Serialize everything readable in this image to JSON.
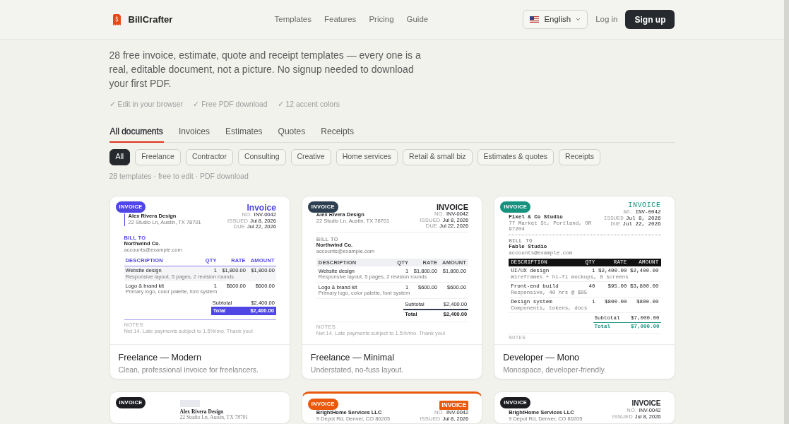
{
  "nav": {
    "brand": "BillCrafter",
    "links": [
      "Templates",
      "Features",
      "Pricing",
      "Guide"
    ],
    "language": "English",
    "login": "Log in",
    "signup": "Sign up"
  },
  "intro": {
    "text": "28 free invoice, estimate, quote and receipt templates — every one is a real, editable document, not a picture. No signup needed to download your first PDF.",
    "features": [
      "✓ Edit in your browser",
      "✓ Free PDF download",
      "✓ 12 accent colors"
    ]
  },
  "tabs": [
    {
      "label": "All documents",
      "selected": true
    },
    {
      "label": "Invoices",
      "selected": false
    },
    {
      "label": "Estimates",
      "selected": false
    },
    {
      "label": "Quotes",
      "selected": false
    },
    {
      "label": "Receipts",
      "selected": false
    }
  ],
  "filters": [
    {
      "label": "All",
      "selected": true
    },
    {
      "label": "Freelance",
      "selected": false
    },
    {
      "label": "Contractor",
      "selected": false
    },
    {
      "label": "Consulting",
      "selected": false
    },
    {
      "label": "Creative",
      "selected": false
    },
    {
      "label": "Home services",
      "selected": false
    },
    {
      "label": "Retail & small biz",
      "selected": false
    },
    {
      "label": "Estimates & quotes",
      "selected": false
    },
    {
      "label": "Receipts",
      "selected": false
    }
  ],
  "summary": "28 templates · free to edit · PDF download",
  "templates": [
    {
      "title": "Freelance — Modern",
      "description": "Clean, professional invoice for freelancers.",
      "preview": {
        "kind": "modern",
        "color": "#4f46e5",
        "badge": "INVOICE",
        "heading": "Invoice",
        "from": {
          "name": "Alex Rivera Design",
          "address": "22 Studio Ln, Austin, TX 78701"
        },
        "meta": [
          {
            "label": "NO.",
            "value": "INV-0042"
          },
          {
            "label": "ISSUED",
            "value": "Jul 8, 2026"
          },
          {
            "label": "DUE",
            "value": "Jul 22, 2026"
          }
        ],
        "bill_to": {
          "label": "BILL TO",
          "name": "Northwind Co.",
          "email": "accounts@example.com"
        },
        "columns": [
          "DESCRIPTION",
          "QTY",
          "RATE",
          "AMOUNT"
        ],
        "items": [
          {
            "name": "Website design",
            "detail": "Responsive layout, 5 pages, 2 revision rounds",
            "qty": "1",
            "rate": "$1,800.00",
            "amount": "$1,800.00"
          },
          {
            "name": "Logo & brand kit",
            "detail": "Primary logo, color palette, font system",
            "qty": "1",
            "rate": "$600.00",
            "amount": "$600.00"
          }
        ],
        "subtotal": {
          "label": "Subtotal",
          "value": "$2,400.00"
        },
        "total": {
          "label": "Total",
          "value": "$2,400.00"
        },
        "notes": {
          "label": "NOTES",
          "text": "Net 14. Late payments subject to 1.5%/mo. Thank you!"
        }
      }
    },
    {
      "title": "Freelance — Minimal",
      "description": "Understated, no-fuss layout.",
      "preview": {
        "kind": "minimal",
        "color": "#2c3e50",
        "badge": "INVOICE",
        "heading": "INVOICE",
        "from": {
          "name": "Alex Rivera Design",
          "address": "22 Studio Ln, Austin, TX 78701"
        },
        "meta": [
          {
            "label": "NO.",
            "value": "INV-0042"
          },
          {
            "label": "ISSUED",
            "value": "Jul 8, 2026"
          },
          {
            "label": "DUE",
            "value": "Jul 22, 2026"
          }
        ],
        "bill_to": {
          "label": "BILL TO",
          "name": "Northwind Co.",
          "email": "accounts@example.com"
        },
        "columns": [
          "DESCRIPTION",
          "QTY",
          "RATE",
          "AMOUNT"
        ],
        "items": [
          {
            "name": "Website design",
            "detail": "Responsive layout, 5 pages, 2 revision rounds",
            "qty": "1",
            "rate": "$1,800.00",
            "amount": "$1,800.00"
          },
          {
            "name": "Logo & brand kit",
            "detail": "Primary logo, color palette, font system",
            "qty": "1",
            "rate": "$600.00",
            "amount": "$600.00"
          }
        ],
        "subtotal": {
          "label": "Subtotal",
          "value": "$2,400.00"
        },
        "total": {
          "label": "Total",
          "value": "$2,400.00"
        },
        "notes": {
          "label": "NOTES",
          "text": "Net 14. Late payments subject to 1.5%/mo. Thank you!"
        }
      }
    },
    {
      "title": "Developer — Mono",
      "description": "Monospace, developer-friendly.",
      "preview": {
        "kind": "mono",
        "color": "#16927f",
        "badge": "INVOICE",
        "heading": "INVOICE",
        "from": {
          "name": "Pixel & Co Studio",
          "address": "77 Market St, Portland, OR 97204"
        },
        "meta": [
          {
            "label": "NO.",
            "value": "INV-0042"
          },
          {
            "label": "ISSUED",
            "value": "Jul 8, 2026"
          },
          {
            "label": "DUE",
            "value": "Jul 22, 2026"
          }
        ],
        "bill_to": {
          "label": "BILL TO",
          "name": "Fable Studio",
          "email": "accounts@example.com"
        },
        "columns": [
          "DESCRIPTION",
          "QTY",
          "RATE",
          "AMOUNT"
        ],
        "items": [
          {
            "name": "UI/UX design",
            "detail": "Wireframes + hi-fi mockups, 8 screens",
            "qty": "1",
            "rate": "$2,400.00",
            "amount": "$2,400.00"
          },
          {
            "name": "Front-end build",
            "detail": "Responsive, 40 hrs @ $95",
            "qty": "40",
            "rate": "$95.00",
            "amount": "$3,800.00"
          },
          {
            "name": "Design system",
            "detail": "Components, tokens, docs",
            "qty": "1",
            "rate": "$800.00",
            "amount": "$800.00"
          }
        ],
        "subtotal": {
          "label": "Subtotal",
          "value": "$7,000.00"
        },
        "total": {
          "label": "Total",
          "value": "$7,000.00"
        },
        "notes": {
          "label": "NOTES"
        }
      }
    },
    {
      "preview": {
        "kind": "classic",
        "color": "#1c1d20",
        "badge": "INVOICE",
        "from": {
          "name": "Alex Rivera Design",
          "address": "22 Studio Ln, Austin, TX 78701"
        }
      }
    },
    {
      "preview": {
        "kind": "banner",
        "color": "#ea580c",
        "badge": "INVOICE",
        "heading": "INVOICE",
        "from": {
          "name": "BrightHome Services LLC",
          "address": "9 Depot Rd, Denver, CO 80205"
        },
        "meta": [
          {
            "label": "NO.",
            "value": "INV-0042"
          },
          {
            "label": "ISSUED",
            "value": "Jul 8, 2026"
          }
        ]
      }
    },
    {
      "preview": {
        "kind": "standard",
        "color": "#1c1d20",
        "badge": "INVOICE",
        "heading": "INVOICE",
        "from": {
          "name": "BrightHome Services LLC",
          "address": "9 Depot Rd, Denver, CO 80205"
        },
        "meta": [
          {
            "label": "NO.",
            "value": "INV-0042"
          },
          {
            "label": "ISSUED",
            "value": "Jul 8, 2026"
          }
        ]
      }
    }
  ]
}
